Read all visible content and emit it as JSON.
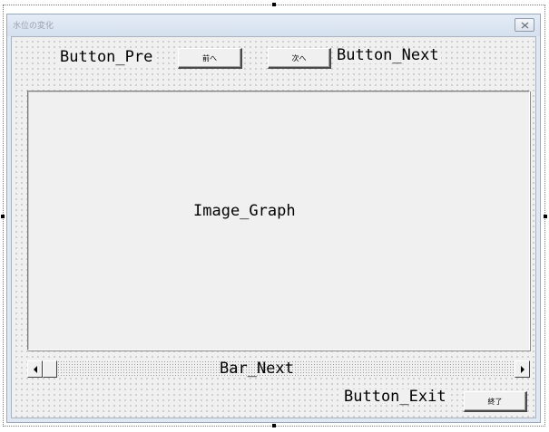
{
  "form": {
    "title": "水位の変化"
  },
  "controls": {
    "button_pre_name": "Button_Pre",
    "button_pre_caption": "前へ",
    "button_next_caption": "次へ",
    "button_next_name": "Button_Next",
    "image_name": "Image_Graph",
    "bar_name": "Bar_Next",
    "button_exit_name": "Button_Exit",
    "button_exit_caption": "終了"
  },
  "icons": {
    "close": "close-icon",
    "scroll_left": "scroll-left-arrow-icon",
    "scroll_right": "scroll-right-arrow-icon"
  },
  "scrollbar": {
    "position_fraction": 0
  },
  "colors": {
    "form_background": "#f0f0f0",
    "titlebar": "#dfe8f3",
    "grid_dot": "#6d6d6d"
  }
}
